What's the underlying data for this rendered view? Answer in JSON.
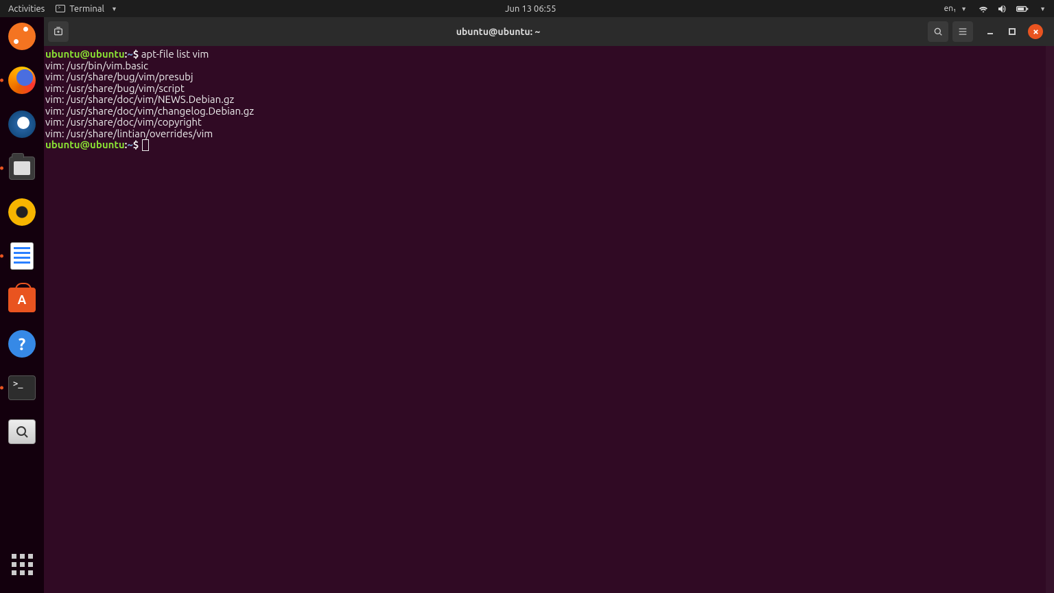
{
  "topbar": {
    "activities": "Activities",
    "app_menu_label": "Terminal",
    "clock": "Jun 13  06:55",
    "lang": "en₁"
  },
  "dock": {
    "items": [
      {
        "name": "show-applications-ubuntu",
        "running": false
      },
      {
        "name": "firefox",
        "running": true
      },
      {
        "name": "thunderbird",
        "running": false
      },
      {
        "name": "files",
        "running": true
      },
      {
        "name": "rhythmbox",
        "running": false
      },
      {
        "name": "libreoffice-writer",
        "running": true
      },
      {
        "name": "ubuntu-software",
        "running": false
      },
      {
        "name": "help",
        "running": false
      },
      {
        "name": "terminal",
        "running": true
      },
      {
        "name": "image-viewer",
        "running": false
      }
    ]
  },
  "window": {
    "title": "ubuntu@ubuntu: ~"
  },
  "terminal": {
    "prompt_user": "ubuntu@ubuntu",
    "prompt_sep1": ":",
    "prompt_path": "~",
    "prompt_sep2": "$",
    "command": "apt-file list vim",
    "output_lines": [
      "vim: /usr/bin/vim.basic",
      "vim: /usr/share/bug/vim/presubj",
      "vim: /usr/share/bug/vim/script",
      "vim: /usr/share/doc/vim/NEWS.Debian.gz",
      "vim: /usr/share/doc/vim/changelog.Debian.gz",
      "vim: /usr/share/doc/vim/copyright",
      "vim: /usr/share/lintian/overrides/vim"
    ]
  }
}
